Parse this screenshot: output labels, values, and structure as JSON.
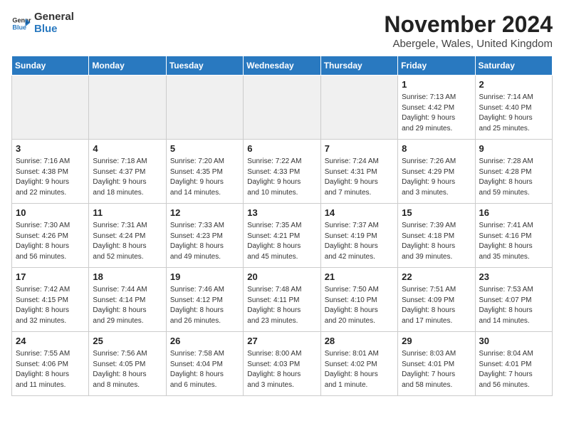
{
  "header": {
    "logo_line1": "General",
    "logo_line2": "Blue",
    "title": "November 2024",
    "subtitle": "Abergele, Wales, United Kingdom"
  },
  "weekdays": [
    "Sunday",
    "Monday",
    "Tuesday",
    "Wednesday",
    "Thursday",
    "Friday",
    "Saturday"
  ],
  "weeks": [
    [
      {
        "day": "",
        "info": "",
        "empty": true
      },
      {
        "day": "",
        "info": "",
        "empty": true
      },
      {
        "day": "",
        "info": "",
        "empty": true
      },
      {
        "day": "",
        "info": "",
        "empty": true
      },
      {
        "day": "",
        "info": "",
        "empty": true
      },
      {
        "day": "1",
        "info": "Sunrise: 7:13 AM\nSunset: 4:42 PM\nDaylight: 9 hours\nand 29 minutes."
      },
      {
        "day": "2",
        "info": "Sunrise: 7:14 AM\nSunset: 4:40 PM\nDaylight: 9 hours\nand 25 minutes."
      }
    ],
    [
      {
        "day": "3",
        "info": "Sunrise: 7:16 AM\nSunset: 4:38 PM\nDaylight: 9 hours\nand 22 minutes."
      },
      {
        "day": "4",
        "info": "Sunrise: 7:18 AM\nSunset: 4:37 PM\nDaylight: 9 hours\nand 18 minutes."
      },
      {
        "day": "5",
        "info": "Sunrise: 7:20 AM\nSunset: 4:35 PM\nDaylight: 9 hours\nand 14 minutes."
      },
      {
        "day": "6",
        "info": "Sunrise: 7:22 AM\nSunset: 4:33 PM\nDaylight: 9 hours\nand 10 minutes."
      },
      {
        "day": "7",
        "info": "Sunrise: 7:24 AM\nSunset: 4:31 PM\nDaylight: 9 hours\nand 7 minutes."
      },
      {
        "day": "8",
        "info": "Sunrise: 7:26 AM\nSunset: 4:29 PM\nDaylight: 9 hours\nand 3 minutes."
      },
      {
        "day": "9",
        "info": "Sunrise: 7:28 AM\nSunset: 4:28 PM\nDaylight: 8 hours\nand 59 minutes."
      }
    ],
    [
      {
        "day": "10",
        "info": "Sunrise: 7:30 AM\nSunset: 4:26 PM\nDaylight: 8 hours\nand 56 minutes."
      },
      {
        "day": "11",
        "info": "Sunrise: 7:31 AM\nSunset: 4:24 PM\nDaylight: 8 hours\nand 52 minutes."
      },
      {
        "day": "12",
        "info": "Sunrise: 7:33 AM\nSunset: 4:23 PM\nDaylight: 8 hours\nand 49 minutes."
      },
      {
        "day": "13",
        "info": "Sunrise: 7:35 AM\nSunset: 4:21 PM\nDaylight: 8 hours\nand 45 minutes."
      },
      {
        "day": "14",
        "info": "Sunrise: 7:37 AM\nSunset: 4:19 PM\nDaylight: 8 hours\nand 42 minutes."
      },
      {
        "day": "15",
        "info": "Sunrise: 7:39 AM\nSunset: 4:18 PM\nDaylight: 8 hours\nand 39 minutes."
      },
      {
        "day": "16",
        "info": "Sunrise: 7:41 AM\nSunset: 4:16 PM\nDaylight: 8 hours\nand 35 minutes."
      }
    ],
    [
      {
        "day": "17",
        "info": "Sunrise: 7:42 AM\nSunset: 4:15 PM\nDaylight: 8 hours\nand 32 minutes."
      },
      {
        "day": "18",
        "info": "Sunrise: 7:44 AM\nSunset: 4:14 PM\nDaylight: 8 hours\nand 29 minutes."
      },
      {
        "day": "19",
        "info": "Sunrise: 7:46 AM\nSunset: 4:12 PM\nDaylight: 8 hours\nand 26 minutes."
      },
      {
        "day": "20",
        "info": "Sunrise: 7:48 AM\nSunset: 4:11 PM\nDaylight: 8 hours\nand 23 minutes."
      },
      {
        "day": "21",
        "info": "Sunrise: 7:50 AM\nSunset: 4:10 PM\nDaylight: 8 hours\nand 20 minutes."
      },
      {
        "day": "22",
        "info": "Sunrise: 7:51 AM\nSunset: 4:09 PM\nDaylight: 8 hours\nand 17 minutes."
      },
      {
        "day": "23",
        "info": "Sunrise: 7:53 AM\nSunset: 4:07 PM\nDaylight: 8 hours\nand 14 minutes."
      }
    ],
    [
      {
        "day": "24",
        "info": "Sunrise: 7:55 AM\nSunset: 4:06 PM\nDaylight: 8 hours\nand 11 minutes."
      },
      {
        "day": "25",
        "info": "Sunrise: 7:56 AM\nSunset: 4:05 PM\nDaylight: 8 hours\nand 8 minutes."
      },
      {
        "day": "26",
        "info": "Sunrise: 7:58 AM\nSunset: 4:04 PM\nDaylight: 8 hours\nand 6 minutes."
      },
      {
        "day": "27",
        "info": "Sunrise: 8:00 AM\nSunset: 4:03 PM\nDaylight: 8 hours\nand 3 minutes."
      },
      {
        "day": "28",
        "info": "Sunrise: 8:01 AM\nSunset: 4:02 PM\nDaylight: 8 hours\nand 1 minute."
      },
      {
        "day": "29",
        "info": "Sunrise: 8:03 AM\nSunset: 4:01 PM\nDaylight: 7 hours\nand 58 minutes."
      },
      {
        "day": "30",
        "info": "Sunrise: 8:04 AM\nSunset: 4:01 PM\nDaylight: 7 hours\nand 56 minutes."
      }
    ]
  ]
}
